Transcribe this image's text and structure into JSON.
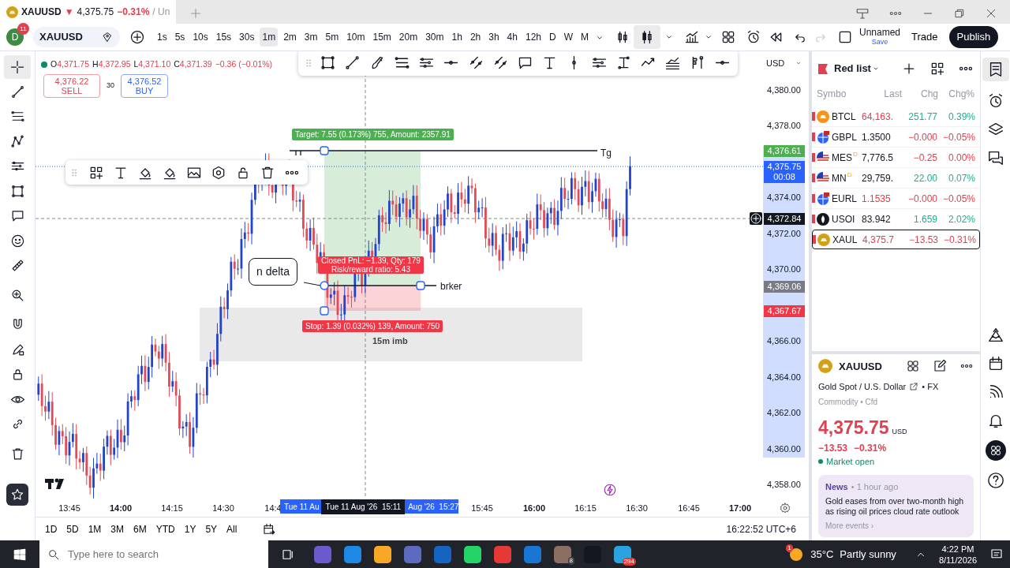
{
  "tab": {
    "symbol": "XAUUSD",
    "arrow": "▼",
    "price": "4,375.75",
    "change": "−0.31%",
    "rest": "/ Un"
  },
  "header": {
    "avatar": "D",
    "notifications": "11",
    "symbol": "XAUUSD",
    "intervals": [
      {
        "label": "1s",
        "selected": false
      },
      {
        "label": "5s",
        "selected": false
      },
      {
        "label": "10s",
        "selected": false
      },
      {
        "label": "15s",
        "selected": false
      },
      {
        "label": "30s",
        "selected": false
      },
      {
        "label": "1m",
        "selected": true
      },
      {
        "label": "2m",
        "selected": false
      },
      {
        "label": "3m",
        "selected": false
      },
      {
        "label": "5m",
        "selected": false
      },
      {
        "label": "10m",
        "selected": false
      },
      {
        "label": "15m",
        "selected": false
      },
      {
        "label": "20m",
        "selected": false
      },
      {
        "label": "30m",
        "selected": false
      },
      {
        "label": "1h",
        "selected": false
      },
      {
        "label": "2h",
        "selected": false
      },
      {
        "label": "3h",
        "selected": false
      },
      {
        "label": "4h",
        "selected": false
      },
      {
        "label": "12h",
        "selected": false
      },
      {
        "label": "D",
        "selected": false
      },
      {
        "label": "W",
        "selected": false
      },
      {
        "label": "M",
        "selected": false
      }
    ],
    "layout_name": "Unnamed",
    "save": "Save",
    "trade": "Trade",
    "publish": "Publish"
  },
  "legend": {
    "ohlc": [
      {
        "label": "O",
        "value": "4,371.75"
      },
      {
        "label": "H",
        "value": "4,372.95"
      },
      {
        "label": "L",
        "value": "4,371.10"
      },
      {
        "label": "C",
        "value": "4,371.39"
      }
    ],
    "change": "−0.36 (−0.01%)",
    "sell_price": "4,376.22",
    "sell": "SELL",
    "spread": "30",
    "buy_price": "4,376.52",
    "buy": "BUY"
  },
  "currency": "USD",
  "price_axis": {
    "labels": [
      "4,380.00",
      "4,378.00",
      "4,374.00",
      "4,372.00",
      "4,370.00",
      "4,366.00",
      "4,364.00",
      "4,362.00",
      "4,360.00",
      "4,358.00"
    ]
  },
  "price_tags": [
    {
      "kind": "target",
      "text": "4,376.61"
    },
    {
      "kind": "last",
      "text": "4,375.75",
      "sub": "00:08"
    },
    {
      "kind": "crosshair",
      "text": "4,372.84"
    },
    {
      "kind": "entry",
      "text": "4,369.06"
    },
    {
      "kind": "stop",
      "text": "4,367.67"
    }
  ],
  "time_axis": {
    "labels": [
      {
        "text": "13:45",
        "bold": false
      },
      {
        "text": "14:00",
        "bold": true
      },
      {
        "text": "14:15",
        "bold": false
      },
      {
        "text": "14:30",
        "bold": false
      },
      {
        "text": "14:4",
        "bold": false
      },
      {
        "text": "15:45",
        "bold": false
      },
      {
        "text": "16:00",
        "bold": true
      },
      {
        "text": "16:15",
        "bold": false
      },
      {
        "text": "16:30",
        "bold": false
      },
      {
        "text": "16:45",
        "bold": false
      },
      {
        "text": "17:00",
        "bold": true
      }
    ],
    "range_start": "Tue 11 Au",
    "crosshair": "Tue 11 Aug '26  15:11",
    "range_end": "Aug '26  15:27"
  },
  "drawings": {
    "target_label": "Target: 7.55 (0.173%) 755, Amount: 2357.91",
    "pnl_label": [
      "Closed PnL: −1.39, Qty: 179",
      "Risk/reward ratio: 5.43"
    ],
    "stop_label": "Stop: 1.39 (0.032%) 139, Amount: 750",
    "callout": "n delta",
    "entry_text": "brker",
    "target_text": "Tg",
    "zone_label": "15m imb"
  },
  "range_buttons": [
    "1D",
    "5D",
    "1M",
    "3M",
    "6M",
    "YTD",
    "1Y",
    "5Y",
    "All"
  ],
  "clock": "16:22:52 UTC+6",
  "watchlist": {
    "title": "Red list",
    "columns": [
      "Symbo",
      "Last",
      "Chg",
      "Chg%"
    ],
    "rows": [
      {
        "kind": "crypto",
        "symbol": "BTCL",
        "last": "64,163.",
        "chg": "251.77",
        "chg_pct": "0.39%",
        "last_down": true,
        "rising": true,
        "selected": false
      },
      {
        "kind": "forex",
        "symbol": "GBPL",
        "last": "1.3500",
        "chg": "−0.000",
        "chg_pct": "−0.05%",
        "last_down": false,
        "rising": false,
        "selected": false
      },
      {
        "kind": "future",
        "symbol": "MES",
        "badge": "D",
        "last": "7,776.5",
        "chg": "−0.25",
        "chg_pct": "0.00%",
        "last_down": false,
        "rising": false,
        "selected": false
      },
      {
        "kind": "future",
        "symbol": "MN",
        "badge": "D",
        "last": "29,759.",
        "chg": "22.00",
        "chg_pct": "0.07%",
        "last_down": false,
        "rising": true,
        "selected": false
      },
      {
        "kind": "forex",
        "symbol": "EURL",
        "last": "1.1535",
        "chg": "−0.000",
        "chg_pct": "−0.05%",
        "last_down": true,
        "rising": false,
        "selected": false
      },
      {
        "kind": "energy",
        "symbol": "USOI",
        "last": "83.942",
        "chg": "1.659",
        "chg_pct": "2.02%",
        "last_down": false,
        "rising": true,
        "selected": false
      },
      {
        "kind": "metal",
        "symbol": "XAUL",
        "last": "4,375.7",
        "chg": "−13.53",
        "chg_pct": "−0.31%",
        "last_down": true,
        "rising": false,
        "selected": true
      }
    ]
  },
  "details": {
    "symbol": "XAUUSD",
    "name": "Gold Spot / U.S. Dollar",
    "exchange": "• FX",
    "category": "Commodity • Cfd",
    "price": "4,375.75",
    "currency": "USD",
    "change": "−13.53",
    "change_pct": "−0.31%",
    "market_status": "Market open",
    "market_open": true,
    "news": {
      "source": "News",
      "age": "• 1 hour ago",
      "headline": "Gold eases from over two-month high as rising oil prices cloud rate outlook",
      "more": "More events ›"
    }
  },
  "taskbar": {
    "search_placeholder": "Type here to search",
    "app_badges": [
      "8",
      "294"
    ],
    "weather_badge": "1",
    "temperature": "35°C",
    "weather": "Partly sunny",
    "time": "4:22 PM",
    "date": "8/11/2026"
  }
}
